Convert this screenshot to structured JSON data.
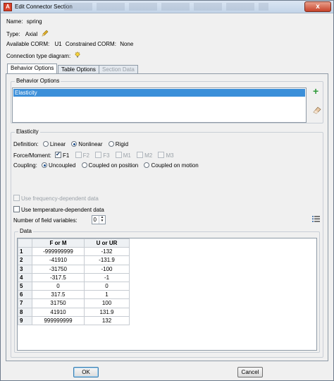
{
  "window": {
    "title": "Edit Connector Section",
    "close_glyph": "x"
  },
  "info": {
    "name_label": "Name:",
    "name_value": "spring",
    "type_label": "Type:",
    "type_value": "Axial",
    "corm_label": "Available CORM:",
    "corm_value": "U1",
    "constrained_label": "Constrained CORM:",
    "constrained_value": "None",
    "diagram_label": "Connection type diagram:"
  },
  "tabs": [
    {
      "label": "Behavior Options",
      "state": "active"
    },
    {
      "label": "Table Options",
      "state": "normal"
    },
    {
      "label": "Section Data",
      "state": "disabled"
    }
  ],
  "behavior": {
    "group_label": "Behavior Options",
    "items": [
      "Elasticity"
    ],
    "add_glyph": "+"
  },
  "elasticity": {
    "group_label": "Elasticity",
    "definition_label": "Definition:",
    "definition_options": [
      "Linear",
      "Nonlinear",
      "Rigid"
    ],
    "definition_selected": "Nonlinear",
    "force_label": "Force/Moment:",
    "force_options": [
      "F1",
      "F2",
      "F3",
      "M1",
      "M2",
      "M3"
    ],
    "coupling_label": "Coupling:",
    "coupling_options": [
      "Uncoupled",
      "Coupled on position",
      "Coupled on motion"
    ],
    "coupling_selected": "Uncoupled",
    "freq_label": "Use frequency-dependent data",
    "temp_label": "Use temperature-dependent data",
    "fields_label": "Number of field variables:",
    "fields_value": "0",
    "data_group_label": "Data",
    "table": {
      "columns": [
        "F or M",
        "U or UR"
      ],
      "rows": [
        [
          "1",
          "-999999999",
          "-132"
        ],
        [
          "2",
          "-41910",
          "-131.9"
        ],
        [
          "3",
          "-31750",
          "-100"
        ],
        [
          "4",
          "-317.5",
          "-1"
        ],
        [
          "5",
          "0",
          "0"
        ],
        [
          "6",
          "317.5",
          "1"
        ],
        [
          "7",
          "31750",
          "100"
        ],
        [
          "8",
          "41910",
          "131.9"
        ],
        [
          "9",
          "999999999",
          "132"
        ]
      ]
    }
  },
  "footer": {
    "ok_label": "OK",
    "cancel_label": "Cancel"
  },
  "colors": {
    "selection": "#3b8fd9",
    "add_icon": "#2f9a3a"
  }
}
